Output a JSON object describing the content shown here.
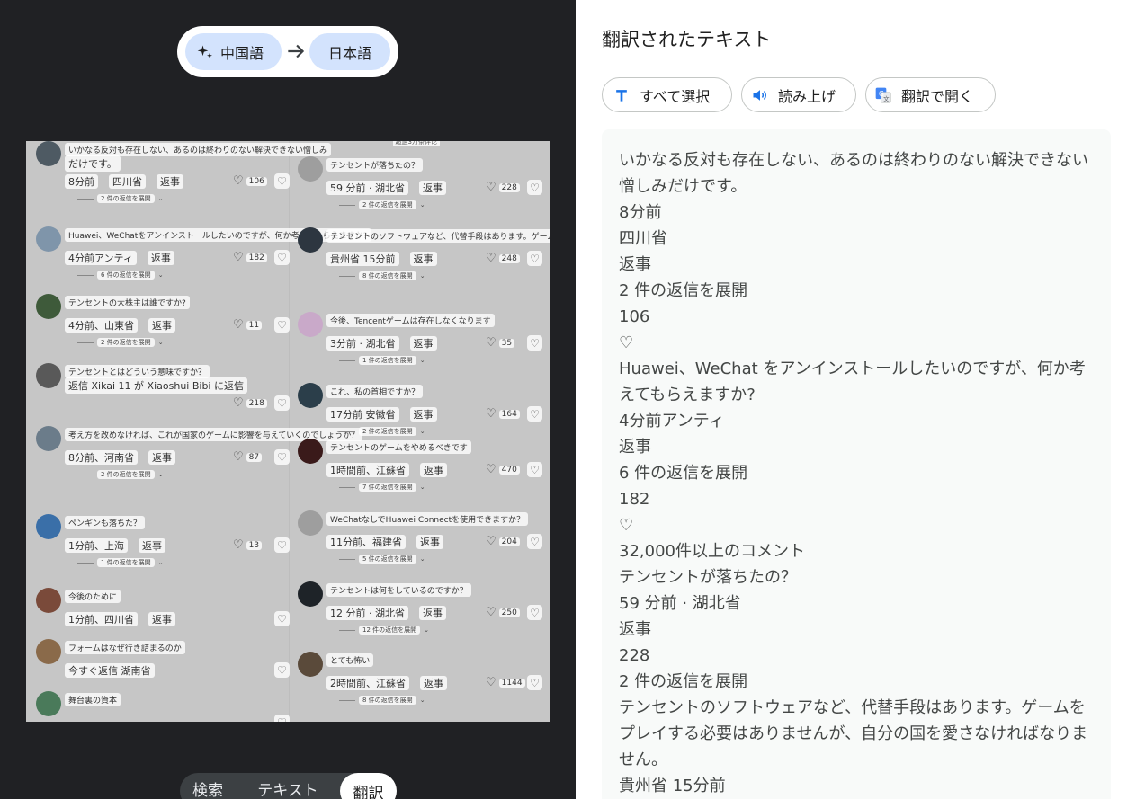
{
  "lang": {
    "source": "中国語",
    "target": "日本語"
  },
  "tabs": [
    "検索",
    "テキスト",
    "翻訳"
  ],
  "right": {
    "title": "翻訳されたテキスト",
    "actions": {
      "select_all": "すべて選択",
      "read_aloud": "読み上げ",
      "open_translate": "翻訳で開く"
    },
    "lines": [
      "いかなる反対も存在しない、あるのは終わりのない解決できない憎しみだけです。",
      "8分前",
      "四川省",
      "返事",
      "2 件の返信を展開",
      "106",
      "♡",
      "Huawei、WeChat をアンインストールしたいのですが、何か考えてもらえますか?",
      "4分前アンティ",
      "返事",
      "6 件の返信を展開",
      "182",
      "♡",
      "32,000件以上のコメント",
      "テンセントが落ちたの？",
      "59 分前 · 湖北省",
      "返事",
      "228",
      "2 件の返信を展開",
      "テンセントのソフトウェアなど、代替手段はあります。ゲームをプレイする必要はありませんが、自分の国を愛さなければなりません。",
      "貴州省 15分前"
    ]
  },
  "screenshot": {
    "top_right_note": "超過3万条评论",
    "left": [
      {
        "text": "いかなる反対も存在しない、あるのは終わりのない解決できない憎しみ",
        "text2": "だけです。",
        "meta": [
          "8分前",
          "四川省",
          "返事"
        ],
        "count": "106",
        "expand": "2 件の返信を展開",
        "avatar": "#4e5a63"
      },
      {
        "text": "Huawei、WeChatをアンインストールしたいのですが、何か考えてもらえますか?",
        "meta": [
          "4分前アンティ",
          "返事"
        ],
        "count": "182",
        "expand": "6 件の返信を展開",
        "avatar": "#7f95aa"
      },
      {
        "text": "テンセントの大株主は誰ですか?",
        "meta": [
          "4分前、山東省",
          "返事"
        ],
        "count": "11",
        "expand": "2 件の返信を展開",
        "avatar": "#3e5a3a"
      },
      {
        "text": "テンセントとはどういう意味ですか？",
        "text2": "返信 Xikai 11 が Xiaoshui Bibi に返信",
        "meta": [],
        "count": "218",
        "expand": "",
        "avatar": "#595959"
      },
      {
        "text": "考え方を改めなければ、これが国家のゲームに影響を与えていくのでしょうか？",
        "meta": [
          "8分前、河南省",
          "返事"
        ],
        "count": "87",
        "expand": "2 件の返信を展開",
        "avatar": "#6b7c8a"
      },
      {
        "text": "ペンギンも落ちた？",
        "meta": [
          "1分前、上海",
          "返事"
        ],
        "count": "13",
        "expand": "1 件の返信を展開",
        "avatar": "#3a6fa8"
      },
      {
        "text": "今後のために",
        "meta": [
          "1分前、四川省",
          "返事"
        ],
        "count": "",
        "expand": "",
        "avatar": "#7a4a3a"
      },
      {
        "text": "フォームはなぜ行き詰まるのか",
        "meta": [
          "今すぐ返信 湖南省"
        ],
        "count": "",
        "expand": "",
        "avatar": "#8a6a4a"
      },
      {
        "text": "舞台裏の資本",
        "meta": [],
        "count": "",
        "expand": "",
        "avatar": "#4a7a5a"
      }
    ],
    "right": [
      {
        "text": "テンセントが落ちたの？",
        "meta": [
          "59 分前 · 湖北省",
          "返事"
        ],
        "count": "228",
        "expand": "2 件の返信を展開",
        "avatar": "#9e9e9e"
      },
      {
        "text": "テンセントのソフトウェアなど、代替手段はあります。ゲームをプレイする必要は",
        "meta": [
          "貴州省 15分前",
          "返事"
        ],
        "count": "248",
        "expand": "8 件の返信を展開",
        "avatar": "#2d3640"
      },
      {
        "text": "今後、Tencentゲームは存在しなくなります",
        "meta": [
          "3分前 · 湖北省",
          "返事"
        ],
        "count": "35",
        "expand": "1 件の返信を展開",
        "avatar": "#c9a9c9"
      },
      {
        "text": "これ、私の首相ですか？",
        "meta": [
          "17分前 安徽省",
          "返事"
        ],
        "count": "164",
        "expand": "2 件の返信を展開",
        "avatar": "#2b3e4a"
      },
      {
        "text": "テンセントのゲームをやめるべきです",
        "meta": [
          "1時間前、江蘇省",
          "返事"
        ],
        "count": "470",
        "expand": "7 件の返信を展開",
        "avatar": "#3a1a1a"
      },
      {
        "text": "WeChatなしでHuawei Connectを使用できますか？",
        "meta": [
          "11分前、福建省",
          "返事"
        ],
        "count": "204",
        "expand": "5 件の返信を展開",
        "avatar": "#9e9e9e"
      },
      {
        "text": "テンセントは何をしているのですか？",
        "meta": [
          "12 分前 · 湖北省",
          "返事"
        ],
        "count": "250",
        "expand": "12 件の返信を展開",
        "avatar": "#1e2328"
      },
      {
        "text": "とても怖い",
        "meta": [
          "2時間前、江蘇省",
          "返事"
        ],
        "count": "1144",
        "expand": "8 件の返信を展開",
        "avatar": "#5a4a3a"
      }
    ]
  },
  "colors": {
    "left_bg": "#202124",
    "chip": "#d3e3fd",
    "accent": "#1a73e8",
    "result_bg": "#f8faf9"
  }
}
